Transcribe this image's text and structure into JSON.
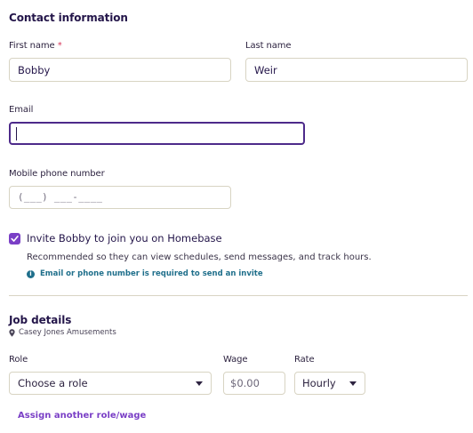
{
  "contact": {
    "title": "Contact information",
    "first_name_label": "First name",
    "required_mark": "*",
    "first_name_value": "Bobby",
    "last_name_label": "Last name",
    "last_name_value": "Weir",
    "email_label": "Email",
    "email_value": "",
    "phone_label": "Mobile phone number",
    "phone_placeholder": "(___) ___-____",
    "invite_checked": true,
    "invite_label": "Invite Bobby to join you on Homebase",
    "invite_helper": "Recommended so they can view schedules, send messages, and track hours.",
    "invite_info": "Email or phone number is required to send an invite",
    "info_icon_glyph": "i"
  },
  "job": {
    "title": "Job details",
    "location": "Casey Jones Amusements",
    "role_label": "Role",
    "role_value": "Choose a role",
    "wage_label": "Wage",
    "wage_placeholder": "$0.00",
    "rate_label": "Rate",
    "rate_value": "Hourly",
    "assign_link": "Assign another role/wage"
  },
  "colors": {
    "accent": "#7a3fc6",
    "focus_border": "#4d2a8a",
    "info": "#1f6f8b",
    "required": "#d6365a",
    "border": "#d8d4c3"
  }
}
